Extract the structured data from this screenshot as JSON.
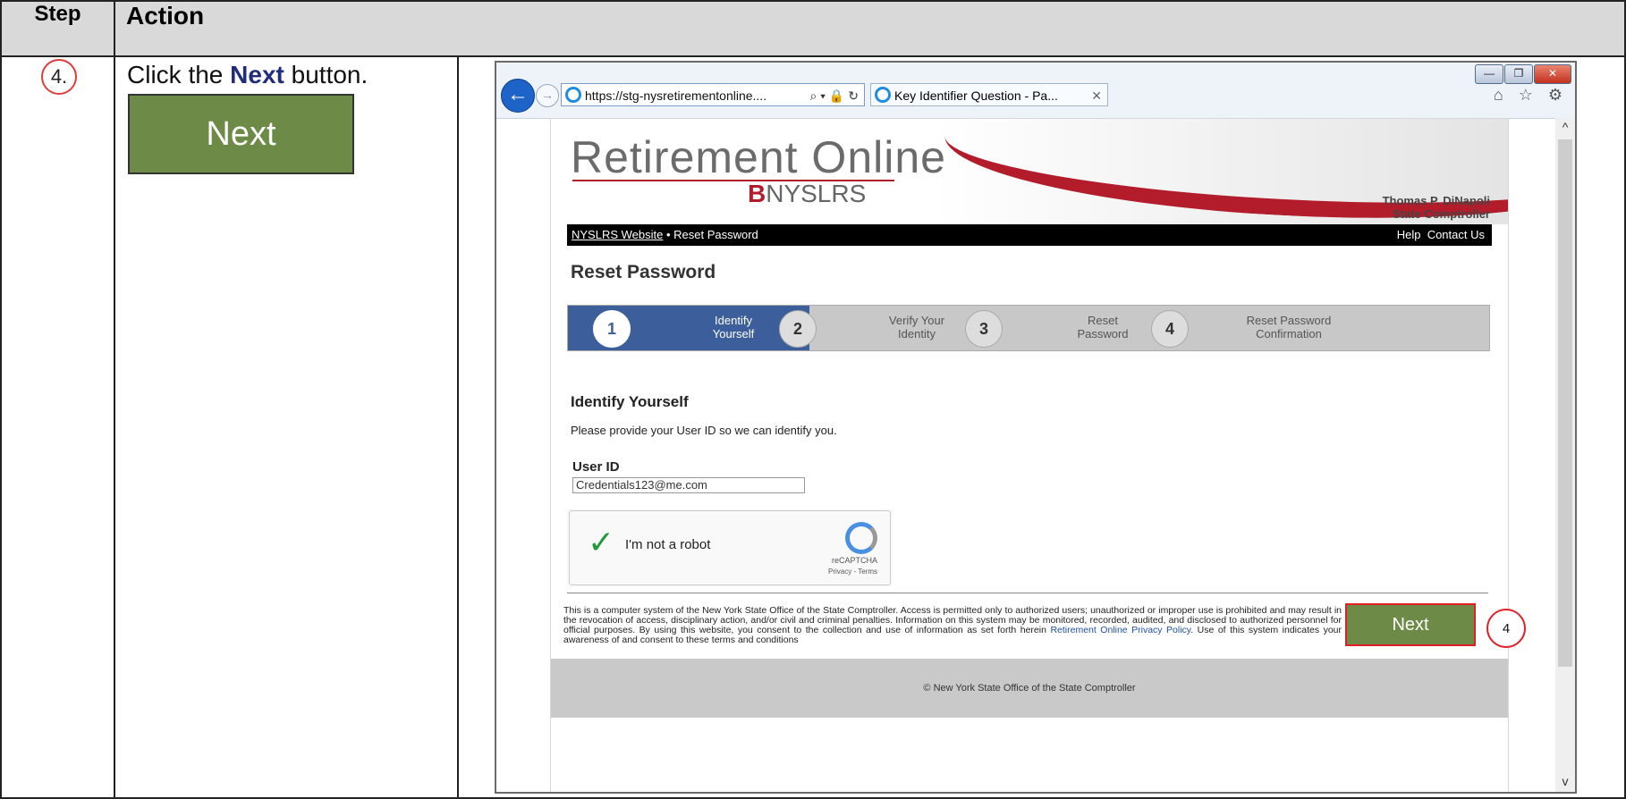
{
  "table": {
    "step_header": "Step",
    "action_header": "Action",
    "step_number": "4.",
    "instruction_prefix": "Click the ",
    "instruction_bold": "Next",
    "instruction_suffix": " button.",
    "big_button_label": "Next"
  },
  "browser": {
    "address": "https://stg-nysretirementonline....",
    "address_tools": "⌕ ▾ 🔒 ↻",
    "tab_title": "Key Identifier Question - Pa...",
    "tab_close": "✕",
    "right_icons": "⌂ ☆ ⚙",
    "win_min": "—",
    "win_max": "❐",
    "win_close": "✕",
    "back": "←",
    "forward": "→",
    "scroll_up": "^",
    "scroll_down": "v"
  },
  "site": {
    "logo_title": "Retirement Online",
    "logo_mark": "B",
    "logo_sub": "NYSLRS",
    "comptroller_name": "Thomas P. DiNapoli",
    "comptroller_title": "State Comptroller",
    "nav_link": "NYSLRS Website",
    "nav_sep": " • ",
    "nav_current": "Reset Password",
    "nav_help": "Help",
    "nav_contact": "Contact Us",
    "page_title": "Reset Password",
    "steps": [
      {
        "num": "1",
        "label_line1": "Identify",
        "label_line2": "Yourself"
      },
      {
        "num": "2",
        "label_line1": "Verify Your",
        "label_line2": "Identity"
      },
      {
        "num": "3",
        "label_line1": "Reset",
        "label_line2": "Password"
      },
      {
        "num": "4",
        "label_line1": "Reset Password",
        "label_line2": "Confirmation"
      }
    ],
    "section_title": "Identify Yourself",
    "section_text": "Please provide your User ID so we can identify you.",
    "user_id_label": "User ID",
    "user_id_value": "Credentials123@me.com",
    "captcha_label": "I'm not a robot",
    "captcha_check": "✓",
    "captcha_brand": "reCAPTCHA",
    "captcha_terms": "Privacy - Terms",
    "disclaimer_text": "This is a computer system of the New York State Office of the State Comptroller. Access is permitted only to authorized users; unauthorized or improper use is prohibited and may result in the revocation of access, disciplinary action, and/or civil and criminal penalties. Information on this system may be monitored, recorded, audited, and disclosed to authorized personnel for official purposes. By using this website, you consent to the collection and use of information as set forth herein ",
    "disclaimer_link": "Retirement Online Privacy Policy",
    "disclaimer_end": ". Use of this system indicates your awareness of and consent to these terms and conditions",
    "next_label": "Next",
    "callout_number": "4",
    "footer_text": "© New York State Office of the State Comptroller"
  },
  "colors": {
    "accent_green": "#6d8a47",
    "highlight_red": "#e01f26",
    "stepper_active": "#3c5f9c",
    "brand_red": "#b31d2b"
  }
}
